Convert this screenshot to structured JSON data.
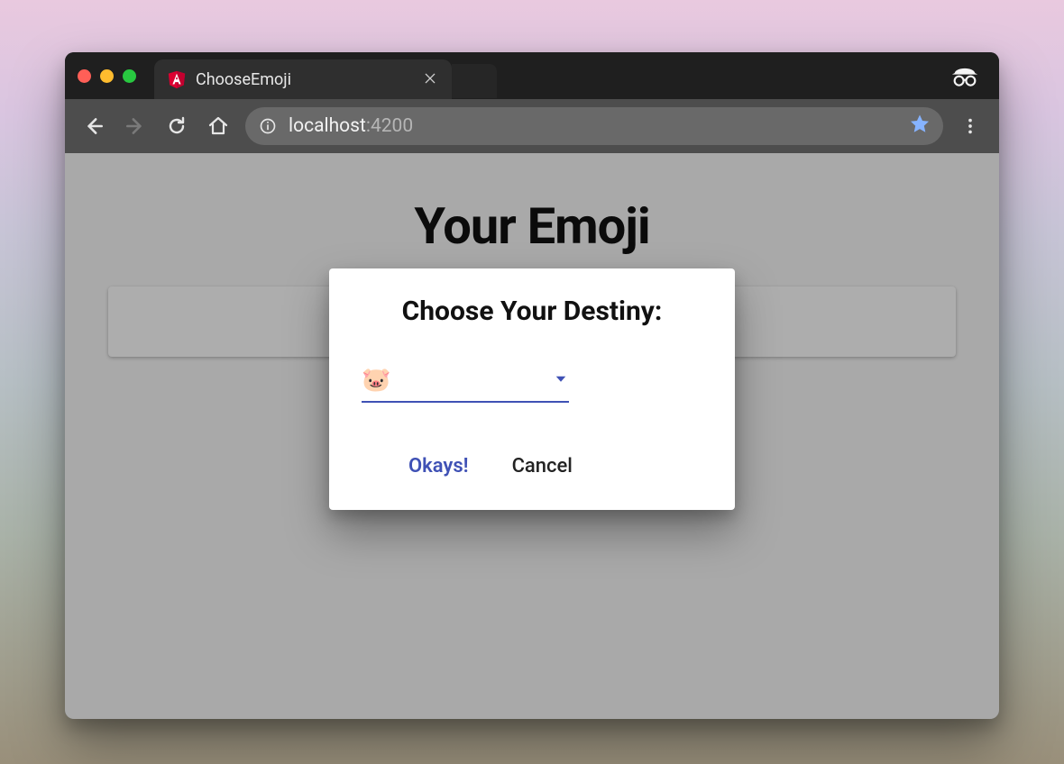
{
  "browser": {
    "tab_title": "ChooseEmoji",
    "url_host": "localhost",
    "url_port": ":4200"
  },
  "page": {
    "title": "Your Emoji"
  },
  "dialog": {
    "title": "Choose Your Destiny:",
    "selected_value": "🐷",
    "ok_label": "Okays!",
    "cancel_label": "Cancel"
  },
  "icons": {
    "angular": "angular-logo",
    "incognito": "incognito-icon"
  },
  "colors": {
    "accent": "#3f51b5"
  }
}
